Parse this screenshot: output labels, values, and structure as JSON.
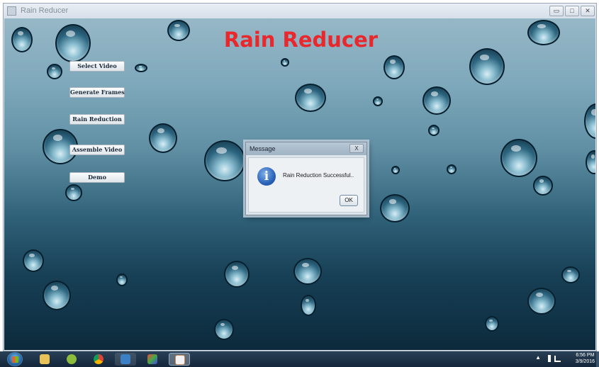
{
  "window": {
    "title": "Rain Reducer",
    "controls": {
      "minimize": "▭",
      "maximize": "□",
      "close": "✕"
    }
  },
  "app": {
    "heading": "Rain Reducer",
    "buttons": {
      "select_video": "Select Video",
      "generate_frames": "Generate Frames",
      "rain_reduction": "Rain Reduction",
      "assemble_video": "Assemble Video",
      "demo": "Demo"
    }
  },
  "dialog": {
    "title": "Message",
    "close_label": "X",
    "icon": "info-icon",
    "icon_glyph": "i",
    "message": "Rain Reduction Successful..",
    "ok_label": "OK"
  },
  "taskbar": {
    "items": [
      "file-explorer-icon",
      "android-icon",
      "chrome-icon",
      "virtualbox-icon",
      "paint-icon",
      "java-icon"
    ],
    "tray_arrow": "▲",
    "time": "6:56 PM",
    "date": "3/9/2016"
  },
  "colors": {
    "heading": "#e8282c",
    "dialog_bg": "#dde4ea",
    "taskbar": "#1b3046"
  }
}
